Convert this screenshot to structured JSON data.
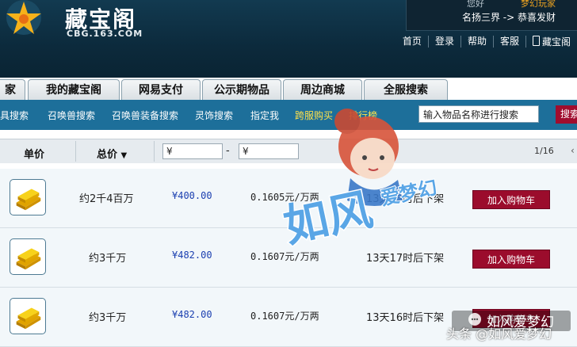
{
  "header": {
    "site_title": "藏宝阁",
    "site_domain": "CBG.163.COM",
    "top_partial_left": "您好",
    "top_partial_right": "梦幻玩家",
    "server_line": "名扬三界 -> 恭喜发财",
    "links": [
      "首页",
      "登录",
      "帮助",
      "客服",
      "藏宝阁"
    ]
  },
  "tabs": [
    "家",
    "我的藏宝阁",
    "网易支付",
    "公示期物品",
    "周边商城",
    "全服搜索"
  ],
  "subnav": {
    "items": [
      "道具搜索",
      "召唤兽搜索",
      "召唤兽装备搜索",
      "灵饰搜索",
      "指定我",
      "跨服购买",
      "排行榜"
    ],
    "search_placeholder": "输入物品名称进行搜索",
    "search_button": "搜索"
  },
  "filter": {
    "col_unit_price": "单价",
    "col_total_price": "总价",
    "sort_icon": "chevron-down-icon",
    "price_min": "¥",
    "price_max": "¥",
    "range_dash": "-",
    "pager": "1/16"
  },
  "rows": [
    {
      "quantity": "约2千4百万",
      "price": "¥400.00",
      "rate": "0.1605元/万两",
      "time_left": "13天23时后下架",
      "cart": "加入购物车"
    },
    {
      "quantity": "约3千万",
      "price": "¥482.00",
      "rate": "0.1607元/万两",
      "time_left": "13天17时后下架",
      "cart": "加入购物车"
    },
    {
      "quantity": "约3千万",
      "price": "¥482.00",
      "rate": "0.1607元/万两",
      "time_left": "13天16时后下架",
      "cart": "加入购物车"
    }
  ],
  "watermark": {
    "mascot_text": "如风",
    "mascot_sub": "爱梦幻",
    "channel_name": "如风爱梦幻",
    "footer": "头条 @如风爱梦幻"
  },
  "colors": {
    "header_bg": "#0c2a3c",
    "subnav_bg": "#1d6f9a",
    "button_red": "#9b0c2c",
    "price_blue": "#1b3fb0"
  }
}
